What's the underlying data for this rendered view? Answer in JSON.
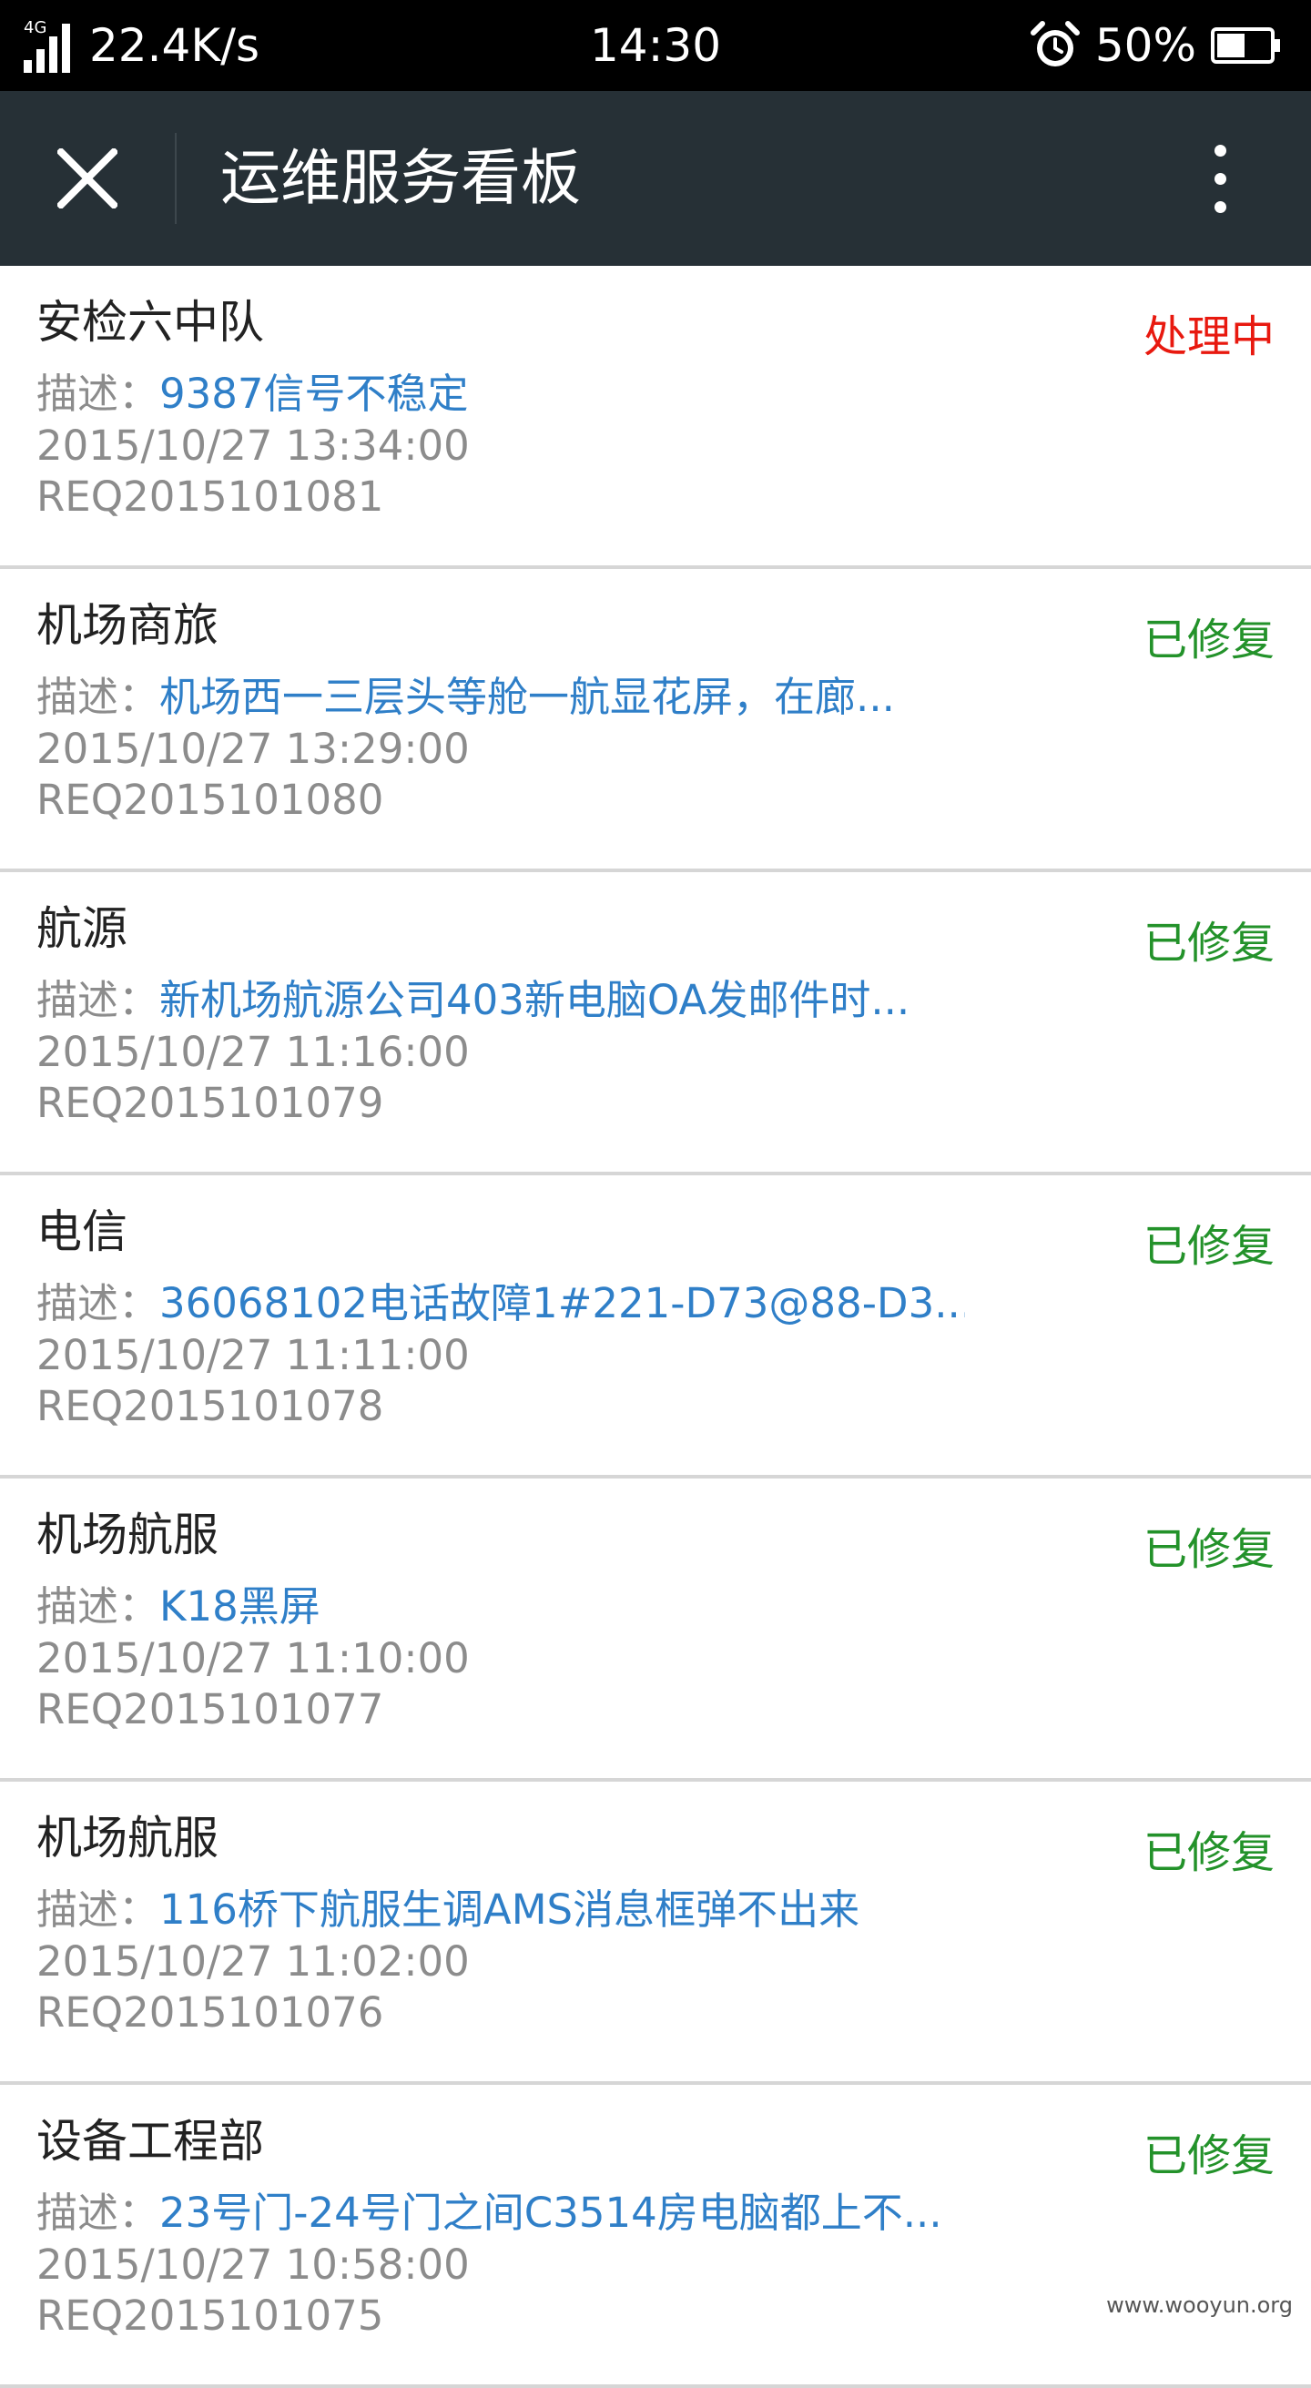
{
  "status_bar": {
    "network": "4G",
    "speed": "22.4K/s",
    "time": "14:30",
    "battery_percent": "50%",
    "icons": [
      "signal-icon",
      "alarm-icon",
      "battery-icon"
    ]
  },
  "app_bar": {
    "title": "运维服务看板",
    "close_icon": "close-icon",
    "more_icon": "more-vertical-icon",
    "background_color": "#263036"
  },
  "colors": {
    "status_processing": "#e8190f",
    "status_fixed": "#23922a",
    "desc_link": "#2f7fc8",
    "meta_text": "#8c8c8c"
  },
  "desc_label": "描述：",
  "items": [
    {
      "title": "安检六中队",
      "status": "处理中",
      "description": "9387信号不稳定",
      "datetime": "2015/10/27 13:34:00",
      "req_id": "REQ2015101081"
    },
    {
      "title": "机场商旅",
      "status": "已修复",
      "description": "机场西一三层头等舱一航显花屏，在廊...",
      "datetime": "2015/10/27 13:29:00",
      "req_id": "REQ2015101080"
    },
    {
      "title": "航源",
      "status": "已修复",
      "description": "新机场航源公司403新电脑OA发邮件时...",
      "datetime": "2015/10/27 11:16:00",
      "req_id": "REQ2015101079"
    },
    {
      "title": "电信",
      "status": "已修复",
      "description": "36068102电话故障1#221-D73@88-D3...",
      "datetime": "2015/10/27 11:11:00",
      "req_id": "REQ2015101078"
    },
    {
      "title": "机场航服",
      "status": "已修复",
      "description": "K18黑屏",
      "datetime": "2015/10/27 11:10:00",
      "req_id": "REQ2015101077"
    },
    {
      "title": "机场航服",
      "status": "已修复",
      "description": "116桥下航服生调AMS消息框弹不出来",
      "datetime": "2015/10/27 11:02:00",
      "req_id": "REQ2015101076"
    },
    {
      "title": "设备工程部",
      "status": "已修复",
      "description": "23号门-24号门之间C3514房电脑都上不...",
      "datetime": "2015/10/27 10:58:00",
      "req_id": "REQ2015101075"
    }
  ],
  "watermark": "www.wooyun.org"
}
